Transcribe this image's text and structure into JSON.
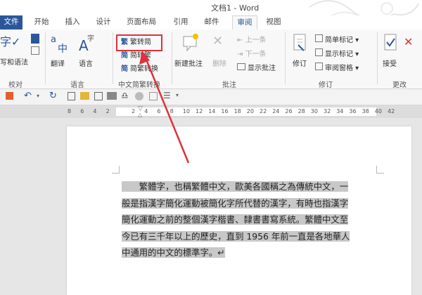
{
  "window": {
    "title": "文档1 - Word"
  },
  "tabs": [
    "文件",
    "开始",
    "插入",
    "设计",
    "页面布局",
    "引用",
    "邮件",
    "审阅",
    "视图"
  ],
  "ribbon": {
    "proofing": {
      "label": "校对",
      "abc_text": "字",
      "button": "写和语法"
    },
    "language": {
      "label": "语言",
      "translate": "翻译",
      "language": "语言"
    },
    "chinese_conv": {
      "label": "中文简繁转换",
      "to_simplified": "繁转简",
      "to_traditional": "简转繁",
      "conversion": "简繁转换"
    },
    "comments": {
      "label": "批注",
      "new": "新建批注",
      "delete": "删除",
      "previous": "上一条",
      "next": "下一条",
      "show": "显示批注"
    },
    "tracking": {
      "label": "修订",
      "track": "修订",
      "simple_markup": "简单标记",
      "show_markup": "显示标记",
      "reviewing_pane": "审阅窗格"
    },
    "changes": {
      "label": "更改",
      "accept": "接受"
    }
  },
  "ruler": {
    "numbers": [
      "8",
      "6",
      "4",
      "2",
      "",
      "2",
      "4",
      "6",
      "8",
      "10",
      "12",
      "14",
      "16",
      "18",
      "20",
      "22",
      "24",
      "26",
      "28",
      "30",
      "32",
      "34",
      "36",
      "38",
      "40",
      "42"
    ]
  },
  "document": {
    "lines": [
      "　　繁體字，也稱繁體中文，歐美各國稱之為傳統中文，一",
      "般是指漢字簡化運動被簡化字所代替的漢字，有時也指漢字",
      "簡化運動之前的整個漢字楷書、隸書書寫系統。繁體中文至",
      "今已有三千年以上的歷史，直到 1956 年前一直是各地華人",
      "中通用的中文的標準字。↵"
    ]
  },
  "colors": {
    "accent": "#2b579a",
    "highlight": "#e0303a"
  }
}
